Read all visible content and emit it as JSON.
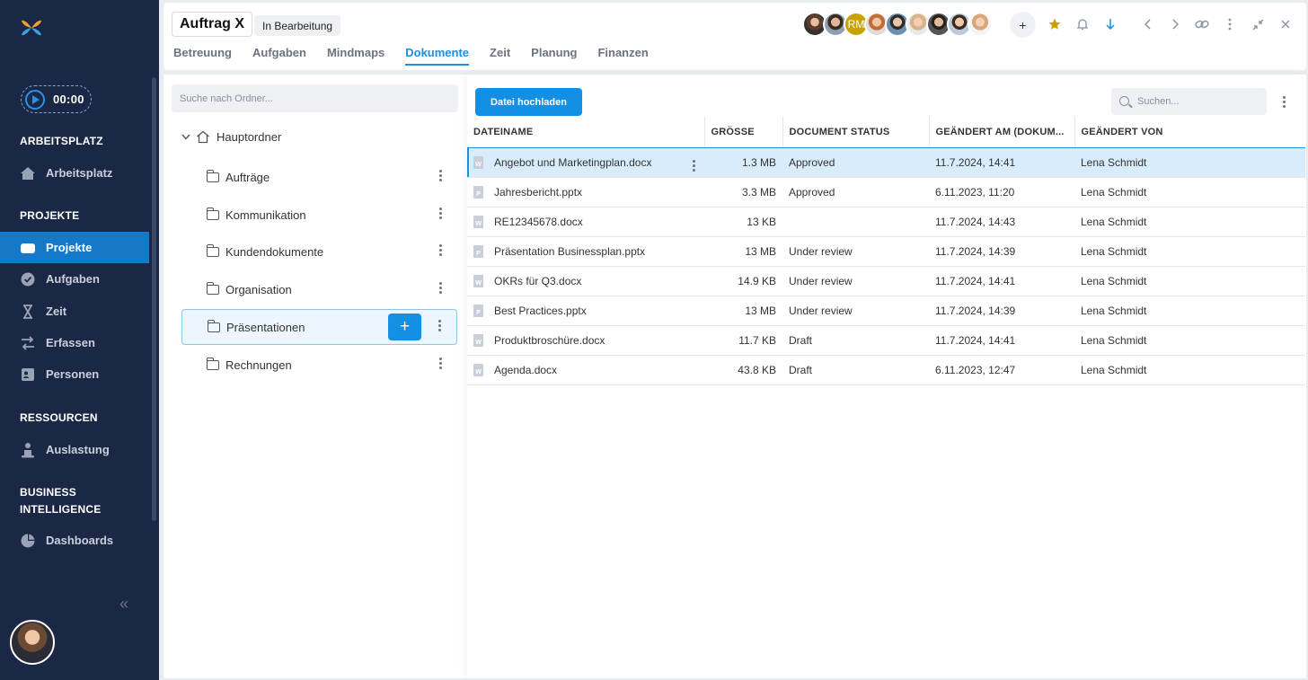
{
  "sidebar": {
    "timer": "00:00",
    "sections": [
      {
        "title": "ARBEITSPLATZ"
      },
      {
        "title": "PROJEKTE"
      },
      {
        "title": "RESSOURCEN"
      },
      {
        "title": "BUSINESS INTELLIGENCE"
      }
    ],
    "items": [
      {
        "label": "Arbeitsplatz",
        "icon": "house-icon"
      },
      {
        "label": "Projekte",
        "icon": "folder-icon",
        "active": true
      },
      {
        "label": "Aufgaben",
        "icon": "check-circle-icon"
      },
      {
        "label": "Zeit",
        "icon": "hourglass-icon"
      },
      {
        "label": "Erfassen",
        "icon": "transfer-icon"
      },
      {
        "label": "Personen",
        "icon": "person-card-icon"
      },
      {
        "label": "Auslastung",
        "icon": "person-load-icon"
      },
      {
        "label": "Dashboards",
        "icon": "pie-chart-icon"
      }
    ],
    "collapse_glyph": "«"
  },
  "header": {
    "title": "Auftrag X",
    "status": "In Bearbeitung",
    "tabs": [
      {
        "label": "Betreuung"
      },
      {
        "label": "Aufgaben"
      },
      {
        "label": "Mindmaps"
      },
      {
        "label": "Dokumente",
        "active": true
      },
      {
        "label": "Zeit"
      },
      {
        "label": "Planung"
      },
      {
        "label": "Finanzen"
      }
    ],
    "avatar_initials": "RM",
    "add_member": "+"
  },
  "folders": {
    "search_placeholder": "Suche nach Ordner...",
    "root": "Hauptordner",
    "items": [
      {
        "label": "Aufträge"
      },
      {
        "label": "Kommunikation"
      },
      {
        "label": "Kundendokumente"
      },
      {
        "label": "Organisation"
      },
      {
        "label": "Präsentationen",
        "active": true
      },
      {
        "label": "Rechnungen"
      }
    ],
    "add_label": "+"
  },
  "documents": {
    "upload_label": "Datei hochladen",
    "search_placeholder": "Suchen...",
    "columns": {
      "name": "DATEINAME",
      "size": "GRÖSSE",
      "status": "DOCUMENT STATUS",
      "changed": "GEÄNDERT AM (DOKUM...",
      "by": "GEÄNDERT VON"
    },
    "rows": [
      {
        "type": "W",
        "name": "Angebot und Marketingplan.docx",
        "size": "1.3 MB",
        "status": "Approved",
        "changed": "11.7.2024, 14:41",
        "by": "Lena Schmidt"
      },
      {
        "type": "P",
        "name": "Jahresbericht.pptx",
        "size": "3.3 MB",
        "status": "Approved",
        "changed": "6.11.2023, 11:20",
        "by": "Lena Schmidt"
      },
      {
        "type": "W",
        "name": "RE12345678.docx",
        "size": "13 KB",
        "status": "",
        "changed": "11.7.2024, 14:43",
        "by": "Lena Schmidt"
      },
      {
        "type": "P",
        "name": "Präsentation Businessplan.pptx",
        "size": "13 MB",
        "status": "Under review",
        "changed": "11.7.2024, 14:39",
        "by": "Lena Schmidt"
      },
      {
        "type": "W",
        "name": "OKRs für Q3.docx",
        "size": "14.9 KB",
        "status": "Under review",
        "changed": "11.7.2024, 14:41",
        "by": "Lena Schmidt"
      },
      {
        "type": "P",
        "name": "Best Practices.pptx",
        "size": "13 MB",
        "status": "Under review",
        "changed": "11.7.2024, 14:39",
        "by": "Lena Schmidt"
      },
      {
        "type": "W",
        "name": "Produktbroschüre.docx",
        "size": "11.7 KB",
        "status": "Draft",
        "changed": "11.7.2024, 14:41",
        "by": "Lena Schmidt"
      },
      {
        "type": "W",
        "name": "Agenda.docx",
        "size": "43.8 KB",
        "status": "Draft",
        "changed": "6.11.2023, 12:47",
        "by": "Lena Schmidt"
      }
    ]
  },
  "colors": {
    "sidebar_bg": "#1b2845",
    "accent": "#1390e4",
    "star": "#c8a200"
  }
}
